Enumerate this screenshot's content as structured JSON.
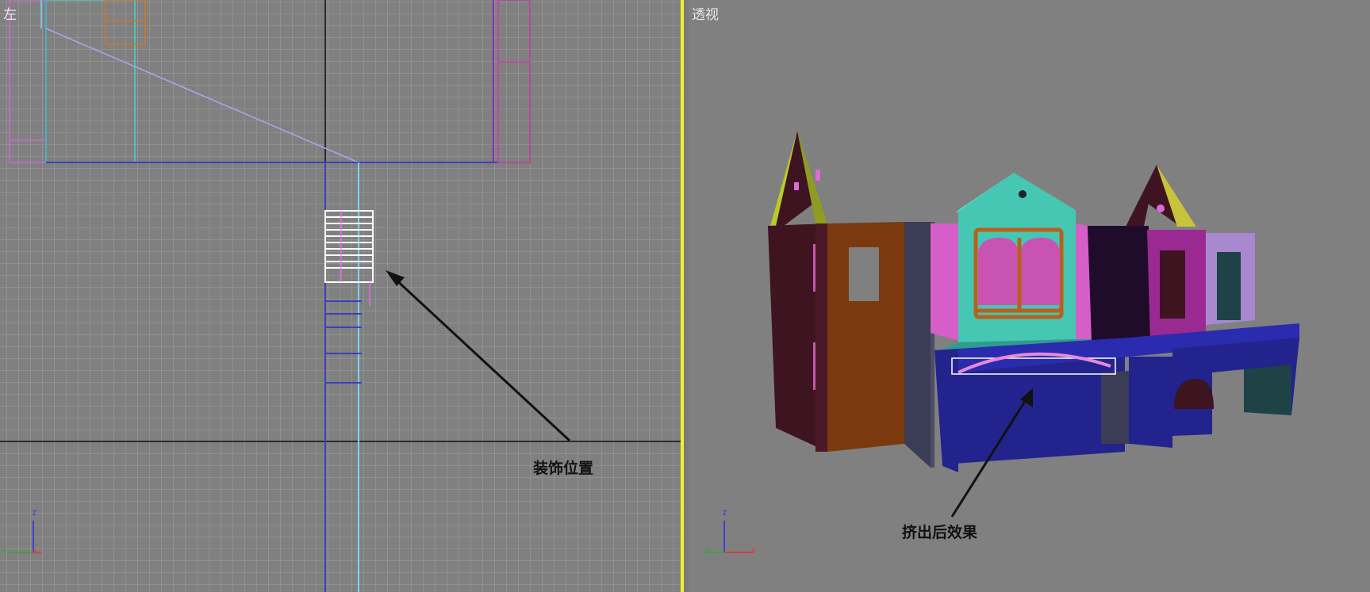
{
  "viewports": {
    "left": {
      "label": "左",
      "annotation": "装饰位置"
    },
    "perspective": {
      "label": "透视",
      "annotation": "挤出后效果"
    }
  },
  "axes": {
    "z": "z",
    "y": "y",
    "x": "x"
  },
  "colors": {
    "viewport_bg": "#808080",
    "grid": "#a2a2a2",
    "active_border": "#f2ef2a",
    "annotation": "#111111"
  }
}
